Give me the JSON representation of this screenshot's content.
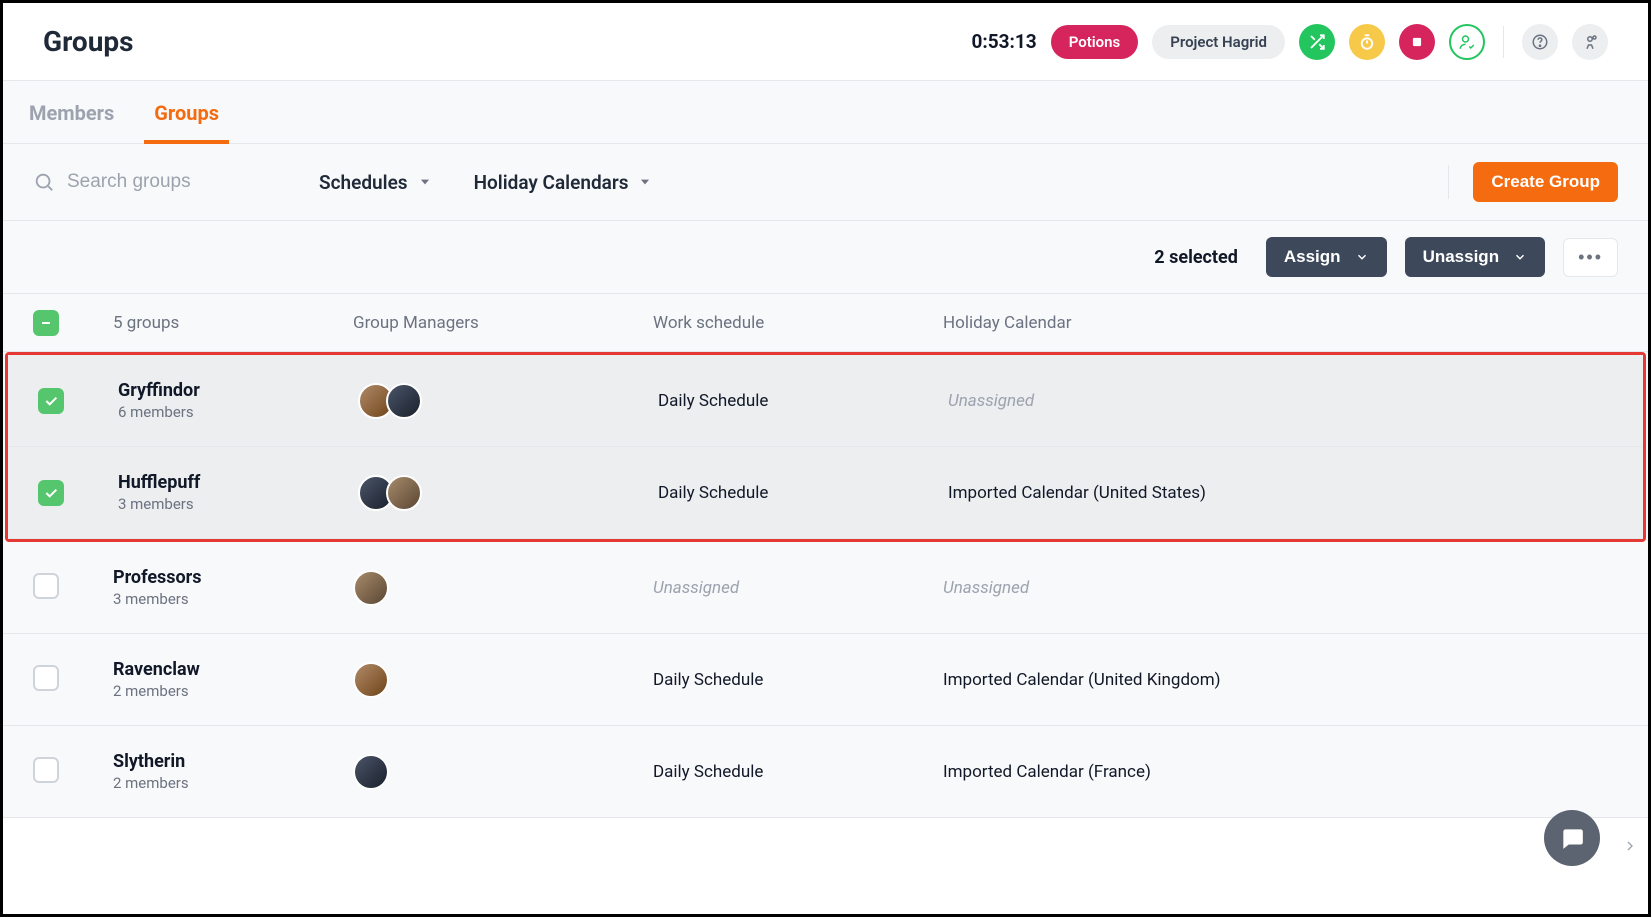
{
  "header": {
    "title": "Groups",
    "timer": "0:53:13",
    "pill_primary": "Potions",
    "pill_secondary": "Project Hagrid"
  },
  "tabs": {
    "members_label": "Members",
    "groups_label": "Groups"
  },
  "filters": {
    "search_placeholder": "Search groups",
    "schedules_label": "Schedules",
    "holidays_label": "Holiday Calendars",
    "create_label": "Create Group"
  },
  "actionbar": {
    "selected_text": "2 selected",
    "assign_label": "Assign",
    "unassign_label": "Unassign"
  },
  "columns": {
    "count": "5 groups",
    "managers": "Group Managers",
    "schedule": "Work schedule",
    "holiday": "Holiday Calendar"
  },
  "rows": [
    {
      "name": "Gryffindor",
      "meta": "6 members",
      "managers": 2,
      "schedule": "Daily Schedule",
      "holiday": "Unassigned",
      "holiday_muted": true,
      "checked": true,
      "highlight": true
    },
    {
      "name": "Hufflepuff",
      "meta": "3 members",
      "managers": 2,
      "schedule": "Daily Schedule",
      "holiday": "Imported Calendar (United States)",
      "holiday_muted": false,
      "checked": true,
      "highlight": true
    },
    {
      "name": "Professors",
      "meta": "3 members",
      "managers": 1,
      "schedule": "Unassigned",
      "schedule_muted": true,
      "holiday": "Unassigned",
      "holiday_muted": true,
      "checked": false,
      "highlight": false
    },
    {
      "name": "Ravenclaw",
      "meta": "2 members",
      "managers": 1,
      "schedule": "Daily Schedule",
      "holiday": "Imported Calendar (United Kingdom)",
      "holiday_muted": false,
      "checked": false,
      "highlight": false
    },
    {
      "name": "Slytherin",
      "meta": "2 members",
      "managers": 1,
      "schedule": "Daily Schedule",
      "holiday": "Imported Calendar (France)",
      "holiday_muted": false,
      "checked": false,
      "highlight": false
    }
  ]
}
